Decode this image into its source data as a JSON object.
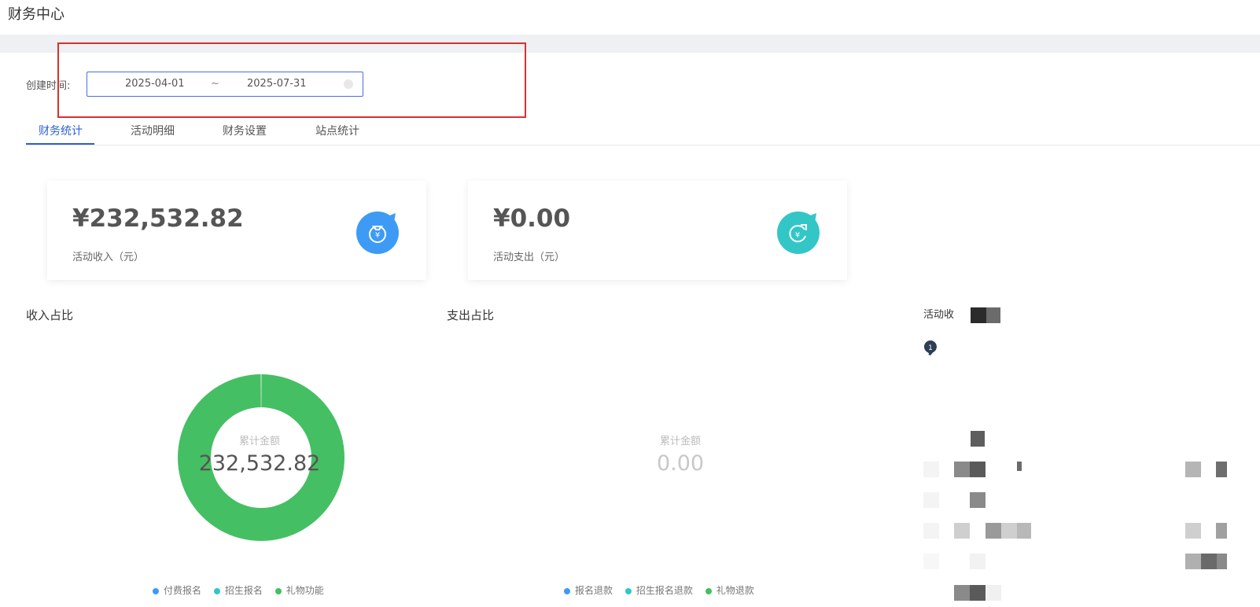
{
  "page": {
    "title": "财务中心"
  },
  "filter": {
    "label": "创建时间:",
    "start": "2025-04-01",
    "separator": "~",
    "end": "2025-07-31"
  },
  "tabs": [
    {
      "label": "财务统计",
      "active": true
    },
    {
      "label": "活动明细",
      "active": false
    },
    {
      "label": "财务设置",
      "active": false
    },
    {
      "label": "站点统计",
      "active": false
    }
  ],
  "cards": {
    "income": {
      "amount": "¥232,532.82",
      "label": "活动收入（元）",
      "icon": "money-bag-icon",
      "color": "#3d9bf5"
    },
    "expense": {
      "amount": "¥0.00",
      "label": "活动支出（元）",
      "icon": "refund-icon",
      "color": "#33c6c6"
    }
  },
  "income_chart": {
    "title": "收入占比",
    "center_caption": "累计金额",
    "center_value": "232,532.82"
  },
  "expense_chart": {
    "title": "支出占比",
    "center_caption": "累计金额",
    "center_value": "0.00"
  },
  "ranking": {
    "title": "活动收",
    "badge": "1"
  },
  "chart_data": [
    {
      "type": "pie",
      "title": "收入占比",
      "categories": [
        "付费报名",
        "招生报名",
        "礼物功能"
      ],
      "values": [
        0,
        0,
        232532.82
      ],
      "colors": [
        "#3d9bf5",
        "#33c6c6",
        "#45bf63"
      ]
    },
    {
      "type": "pie",
      "title": "支出占比",
      "categories": [
        "报名退款",
        "招生报名退款",
        "礼物退款"
      ],
      "values": [
        0,
        0,
        0
      ],
      "colors": [
        "#3d9bf5",
        "#33c6c6",
        "#45bf63"
      ]
    }
  ]
}
